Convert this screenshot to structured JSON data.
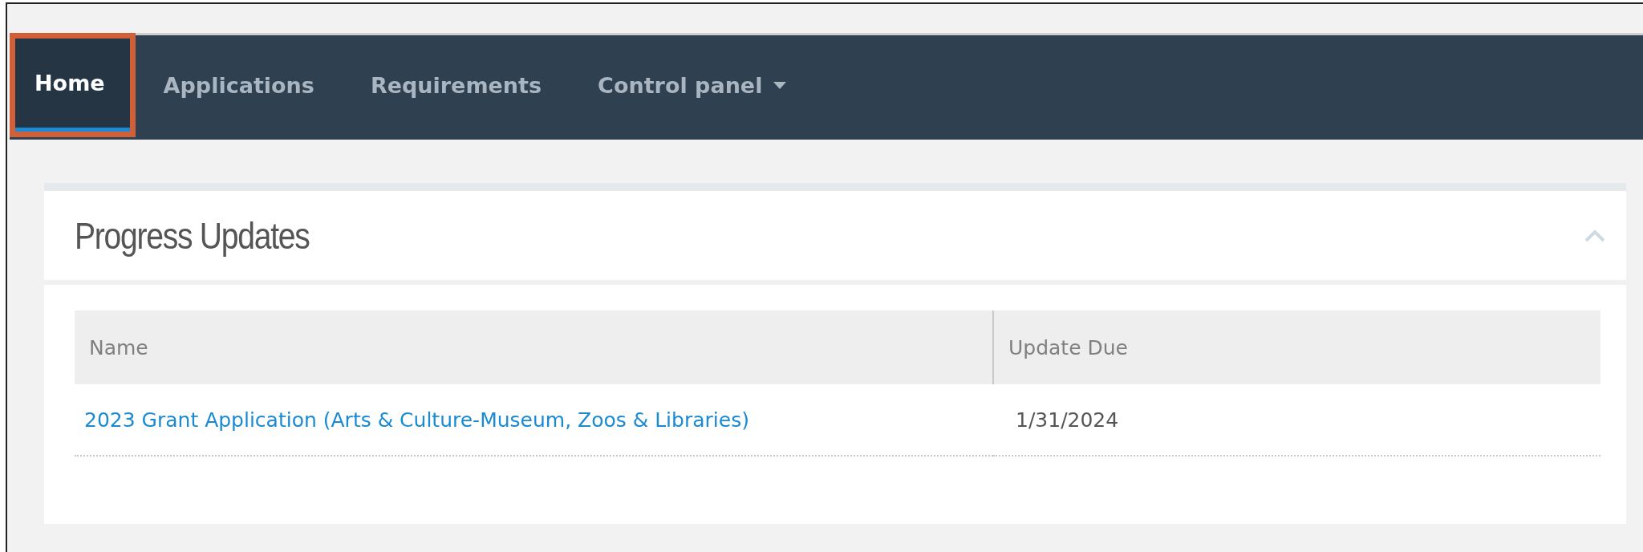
{
  "nav": {
    "tabs": [
      {
        "label": "Home",
        "selected": true,
        "highlighted": true,
        "dropdown": false
      },
      {
        "label": "Applications",
        "selected": false,
        "highlighted": false,
        "dropdown": false
      },
      {
        "label": "Requirements",
        "selected": false,
        "highlighted": false,
        "dropdown": false
      },
      {
        "label": "Control panel",
        "selected": false,
        "highlighted": false,
        "dropdown": true
      }
    ]
  },
  "panel": {
    "title": "Progress Updates",
    "expanded": true,
    "table": {
      "columns": [
        "Name",
        "Update Due"
      ],
      "rows": [
        {
          "name": "2023 Grant Application (Arts & Culture-Museum, Zoos & Libraries)",
          "update_due": "1/31/2024"
        }
      ]
    }
  }
}
